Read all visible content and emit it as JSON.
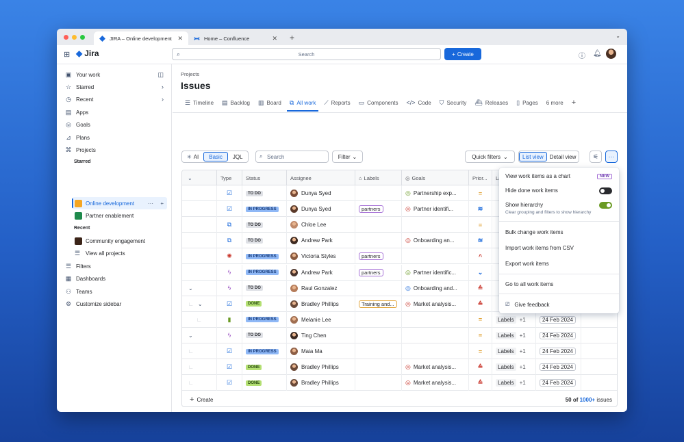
{
  "browser": {
    "tabs": [
      {
        "label": "JIRA – Online development",
        "icon": "jira-icon"
      },
      {
        "label": "Home – Confluence",
        "icon": "confluence-icon"
      }
    ],
    "new_tab": "+"
  },
  "topnav": {
    "app_name": "Jira",
    "search_placeholder": "Search",
    "create_label": "Create"
  },
  "sidebar": {
    "items": [
      {
        "label": "Your work",
        "icon": "your-work-icon"
      },
      {
        "label": "Starred",
        "icon": "star-icon"
      },
      {
        "label": "Recent",
        "icon": "clock-icon"
      },
      {
        "label": "Apps",
        "icon": "apps-icon"
      },
      {
        "label": "Goals",
        "icon": "goals-icon"
      },
      {
        "label": "Plans",
        "icon": "plans-icon"
      },
      {
        "label": "Projects",
        "icon": "projects-icon"
      }
    ],
    "starred_heading": "Starred",
    "starred": [
      {
        "label": "Online development",
        "color": "#f5a623"
      },
      {
        "label": "Partner enablement",
        "color": "#1f8a4c"
      }
    ],
    "recent_heading": "Recent",
    "recent": [
      {
        "label": "Community engagement",
        "color": "#6b3b1f"
      }
    ],
    "view_all": "View all projects",
    "bottom": [
      {
        "label": "Filters",
        "icon": "filter-icon"
      },
      {
        "label": "Dashboards",
        "icon": "dashboard-icon"
      },
      {
        "label": "Teams",
        "icon": "teams-icon"
      },
      {
        "label": "Customize sidebar",
        "icon": "customize-icon"
      }
    ]
  },
  "page": {
    "breadcrumb": "Projects",
    "title": "Issues",
    "tabs": [
      {
        "label": "Timeline",
        "icon": "timeline-icon"
      },
      {
        "label": "Backlog",
        "icon": "backlog-icon"
      },
      {
        "label": "Board",
        "icon": "board-icon"
      },
      {
        "label": "All work",
        "icon": "all-work-icon"
      },
      {
        "label": "Reports",
        "icon": "reports-icon"
      },
      {
        "label": "Components",
        "icon": "components-icon"
      },
      {
        "label": "Code",
        "icon": "code-icon"
      },
      {
        "label": "Security",
        "icon": "security-icon"
      },
      {
        "label": "Releases",
        "icon": "releases-icon"
      },
      {
        "label": "Pages",
        "icon": "pages-icon"
      },
      {
        "label": "6 more",
        "icon": ""
      }
    ],
    "active_tab": "All work"
  },
  "toolbar": {
    "ai": "AI",
    "basic": "Basic",
    "jql": "JQL",
    "search_placeholder": "Search",
    "filter": "Filter",
    "quick_filters": "Quick filters",
    "list_view": "List view",
    "detail_view": "Detail view"
  },
  "table": {
    "headers": [
      "Type",
      "Status",
      "Assignee",
      "Labels",
      "Goals",
      "Prior...",
      "La"
    ],
    "rows": [
      {
        "type": "task",
        "status": "TO DO",
        "assignee": "Dunya Syed",
        "label": "",
        "goal": "Partnership exp...",
        "goal_status": "on-track",
        "priority": "medium",
        "extra_label": "",
        "date": ""
      },
      {
        "type": "task",
        "status": "IN PROGRESS",
        "assignee": "Dunya Syed",
        "label": "partners",
        "goal": "Partner identifi...",
        "goal_status": "off-track",
        "priority": "lowest",
        "extra_label": "",
        "date": ""
      },
      {
        "type": "subtask",
        "status": "TO DO",
        "assignee": "Chloe Lee",
        "label": "",
        "goal": "",
        "goal_status": "",
        "priority": "medium",
        "extra_label": "",
        "date": ""
      },
      {
        "type": "subtask",
        "status": "TO DO",
        "assignee": "Andrew Park",
        "label": "",
        "goal": "Onboarding an...",
        "goal_status": "off-track",
        "priority": "lowest",
        "extra_label": "",
        "date": ""
      },
      {
        "type": "bug",
        "status": "IN PROGRESS",
        "assignee": "Victoria Styles",
        "label": "partners",
        "goal": "",
        "goal_status": "",
        "priority": "high",
        "extra_label": "",
        "date": ""
      },
      {
        "type": "epic",
        "status": "IN PROGRESS",
        "assignee": "Andrew Park",
        "label": "partners",
        "goal": "Partner identific...",
        "goal_status": "on-track",
        "priority": "low",
        "extra_label": "",
        "date": ""
      },
      {
        "type": "epic",
        "status": "TO DO",
        "assignee": "Raul Gonzalez",
        "label": "",
        "goal": "Onboarding and...",
        "goal_status": "pending",
        "priority": "highest",
        "extra_label": "",
        "date": ""
      },
      {
        "type": "task",
        "status": "DONE",
        "assignee": "Bradley Phillips",
        "label": "Training and...",
        "goal": "Market analysis...",
        "goal_status": "off-track",
        "priority": "highest",
        "extra_label": "",
        "date": ""
      },
      {
        "type": "story",
        "status": "IN PROGRESS",
        "assignee": "Melanie Lee",
        "label": "",
        "goal": "",
        "goal_status": "",
        "priority": "medium",
        "extra_label": "Labels",
        "extra_count": "+1",
        "date": "24 Feb 2024"
      },
      {
        "type": "epic",
        "status": "TO DO",
        "assignee": "Ting Chen",
        "label": "",
        "goal": "",
        "goal_status": "",
        "priority": "medium",
        "extra_label": "Labels",
        "extra_count": "+1",
        "date": "24 Feb 2024"
      },
      {
        "type": "task",
        "status": "IN PROGRESS",
        "assignee": "Maia Ma",
        "label": "",
        "goal": "",
        "goal_status": "",
        "priority": "medium",
        "extra_label": "Labels",
        "extra_count": "+1",
        "date": "24 Feb 2024"
      },
      {
        "type": "task",
        "status": "DONE",
        "assignee": "Bradley Phillips",
        "label": "",
        "goal": "Market analysis...",
        "goal_status": "off-track",
        "priority": "highest",
        "extra_label": "Labels",
        "extra_count": "+1",
        "date": "24 Feb 2024"
      },
      {
        "type": "task",
        "status": "DONE",
        "assignee": "Bradley Phillips",
        "label": "",
        "goal": "Market analysis...",
        "goal_status": "off-track",
        "priority": "highest",
        "extra_label": "Labels",
        "extra_count": "+1",
        "date": "24 Feb 2024"
      }
    ],
    "create_label": "Create",
    "count_prefix": "50 of",
    "count_total": "1000+",
    "count_suffix": "issues"
  },
  "menu": {
    "view_chart": "View work items as a chart",
    "new_badge": "NEW",
    "hide_done": "Hide done work items",
    "show_hierarchy": "Show hierarchy",
    "hierarchy_desc": "Clear grouping and filters to show hierarchy",
    "bulk_change": "Bulk change work items",
    "import_csv": "Import work items from CSV",
    "export": "Export work items",
    "go_to_all": "Go to all work items",
    "feedback": "Give feedback"
  },
  "colors": {
    "accent": "#1868db",
    "done": "#b3df72",
    "in_progress": "#8fb8f6",
    "todo": "#dfe1e6"
  }
}
